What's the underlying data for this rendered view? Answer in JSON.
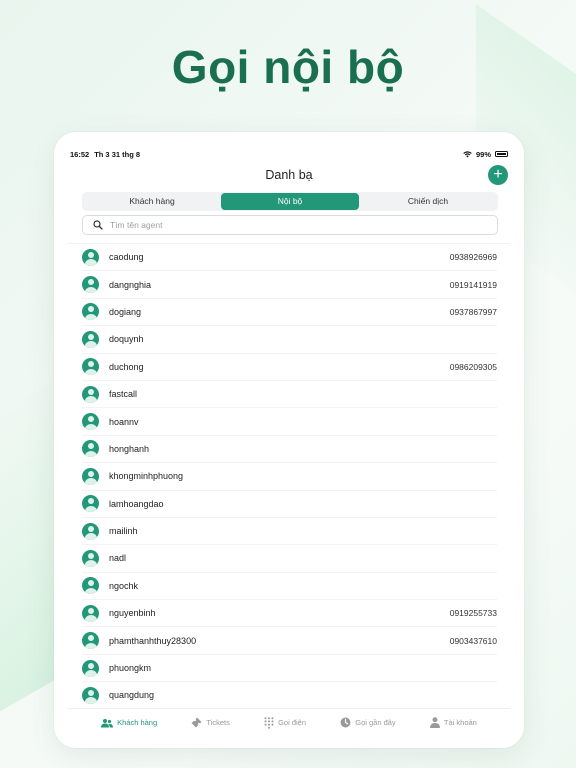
{
  "headline": "Gọi nội bộ",
  "status_bar": {
    "time": "16:52",
    "date": "Th 3 31 thg 8",
    "battery": "99%"
  },
  "nav": {
    "title": "Danh bạ",
    "add_label": "+"
  },
  "segments": [
    {
      "label": "Khách hàng",
      "active": false
    },
    {
      "label": "Nội bộ",
      "active": true
    },
    {
      "label": "Chiến dịch",
      "active": false
    }
  ],
  "search": {
    "placeholder": "Tìm tên agent"
  },
  "contacts": [
    {
      "name": "caodung",
      "phone": "0938926969"
    },
    {
      "name": "dangnghia",
      "phone": "0919141919"
    },
    {
      "name": "dogiang",
      "phone": "0937867997"
    },
    {
      "name": "doquynh",
      "phone": ""
    },
    {
      "name": "duchong",
      "phone": "0986209305"
    },
    {
      "name": "fastcall",
      "phone": ""
    },
    {
      "name": "hoannv",
      "phone": ""
    },
    {
      "name": "honghanh",
      "phone": ""
    },
    {
      "name": "khongminhphuong",
      "phone": ""
    },
    {
      "name": "lamhoangdao",
      "phone": ""
    },
    {
      "name": "mailinh",
      "phone": ""
    },
    {
      "name": "nadl",
      "phone": ""
    },
    {
      "name": "ngochk",
      "phone": ""
    },
    {
      "name": "nguyenbinh",
      "phone": "0919255733"
    },
    {
      "name": "phamthanhthuy28300",
      "phone": "0903437610"
    },
    {
      "name": "phuongkm",
      "phone": ""
    },
    {
      "name": "quangdung",
      "phone": ""
    }
  ],
  "tabs": [
    {
      "label": "Khách hàng",
      "icon": "people-icon",
      "active": true
    },
    {
      "label": "Tickets",
      "icon": "ticket-icon",
      "active": false
    },
    {
      "label": "Gọi điện",
      "icon": "dialpad-icon",
      "active": false
    },
    {
      "label": "Gọi gần đây",
      "icon": "clock-icon",
      "active": false
    },
    {
      "label": "Tài khoản",
      "icon": "person-icon",
      "active": false
    }
  ],
  "colors": {
    "accent": "#22977a",
    "headline": "#1a6e52"
  }
}
